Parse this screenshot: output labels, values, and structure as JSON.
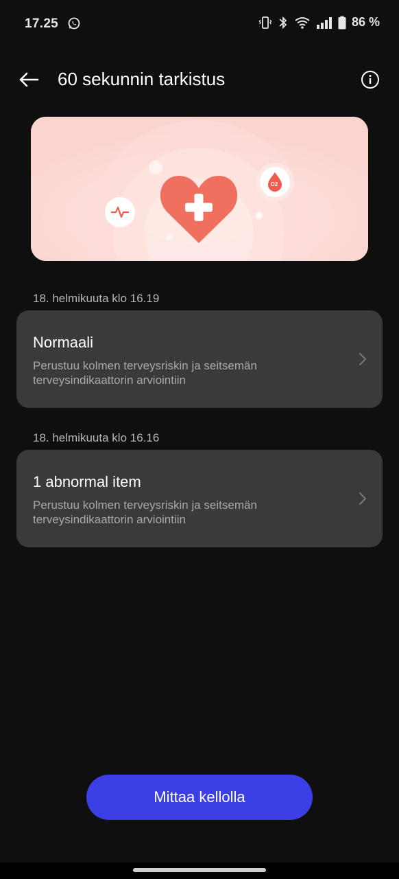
{
  "status": {
    "time": "17.25",
    "battery": "86 %"
  },
  "appbar": {
    "title": "60 sekunnin tarkistus"
  },
  "records": [
    {
      "date": "18. helmikuuta klo 16.19",
      "title": "Normaali",
      "subtitle": "Perustuu kolmen terveysriskin ja seitsemän terveysindikaattorin arviointiin"
    },
    {
      "date": "18. helmikuuta klo 16.16",
      "title": "1 abnormal item",
      "subtitle": "Perustuu kolmen terveysriskin ja seitsemän terveysindikaattorin arviointiin"
    }
  ],
  "banner": {
    "spo2_label": "O2"
  },
  "cta": {
    "label": "Mittaa kellolla"
  },
  "colors": {
    "background": "#0f0f0f",
    "card": "#3a3a3a",
    "accent": "#3d3fe6",
    "banner": "#fbd4d0",
    "heart": "#f07060"
  },
  "icons": [
    "back-arrow-icon",
    "info-icon",
    "chevron-right-icon",
    "whatsapp-icon",
    "vibrate-icon",
    "bluetooth-icon",
    "wifi-icon",
    "signal-icon",
    "battery-icon",
    "heart-plus-icon",
    "heartbeat-icon",
    "oxygen-drop-icon"
  ]
}
